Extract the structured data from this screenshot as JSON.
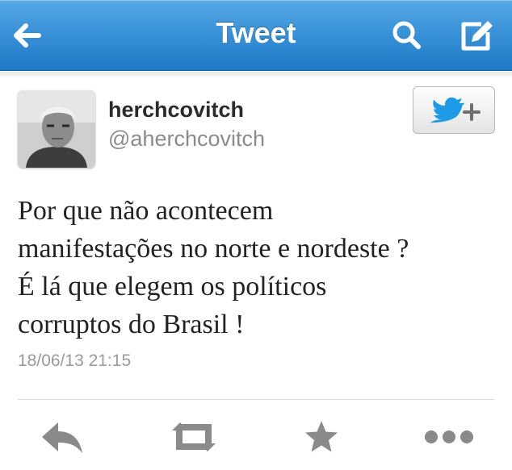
{
  "navbar": {
    "title": "Tweet",
    "background_color": "#3a92d8",
    "icons": [
      "back-arrow-icon",
      "search-icon",
      "compose-icon"
    ]
  },
  "tweet": {
    "author": {
      "display_name": "herchcovitch",
      "handle": "@aherchcovitch"
    },
    "text_lines": [
      "Por que não acontecem",
      "manifestações no norte e nordeste ?",
      "É lá que elegem os políticos",
      "corruptos do Brasil !"
    ],
    "timestamp": "18/06/13 21:15"
  },
  "follow_button": {
    "icons": [
      "twitter-bird-icon",
      "plus-icon"
    ],
    "bird_color": "#1d9be6"
  },
  "actions": {
    "icons": [
      "reply-icon",
      "retweet-icon",
      "favorite-star-icon",
      "more-dots-icon"
    ],
    "icon_color": "#8a8a8a"
  }
}
